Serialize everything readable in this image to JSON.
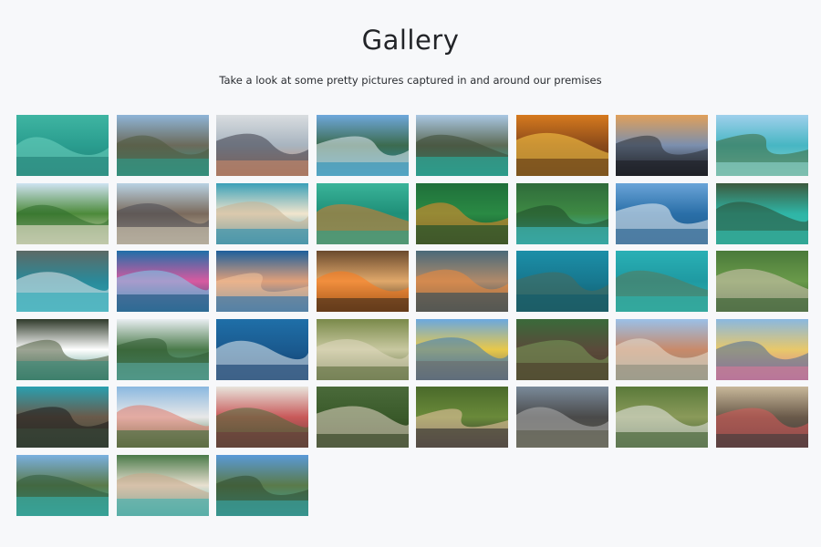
{
  "header": {
    "title": "Gallery",
    "subtitle": "Take a look at some pretty pictures captured in and around our premises"
  },
  "gallery": {
    "photos": [
      {
        "name": "photo-snorkeler-turquoise-water",
        "sky": "#3fb5a2",
        "mid": "#2a9d8f",
        "ground": "#1f7f74",
        "accent": "#6fd3c1"
      },
      {
        "name": "photo-limestone-cliffs-bay",
        "sky": "#8fb5d8",
        "mid": "#6b6a5a",
        "ground": "#2f9c8c",
        "accent": "#4e5a3e"
      },
      {
        "name": "photo-boat-deck-group",
        "sky": "#d9dde0",
        "mid": "#a8b4bf",
        "ground": "#c98a6a",
        "accent": "#3d3d48"
      },
      {
        "name": "photo-speedboat-limestone",
        "sky": "#6fa8dc",
        "mid": "#3c6b4f",
        "ground": "#2a8fb5",
        "accent": "#e8eef2"
      },
      {
        "name": "photo-cliffs-lagoon",
        "sky": "#a9c7e3",
        "mid": "#5d6b56",
        "ground": "#2ab2a4",
        "accent": "#3d4a35"
      },
      {
        "name": "photo-sunset-sea",
        "sky": "#d67a1e",
        "mid": "#8a4a1a",
        "ground": "#5a3313",
        "accent": "#ffcf4a"
      },
      {
        "name": "photo-palm-sunset",
        "sky": "#e0a05a",
        "mid": "#7b8fae",
        "ground": "#1c1e25",
        "accent": "#2a2d33"
      },
      {
        "name": "photo-islet-crystal-water",
        "sky": "#9fd0ec",
        "mid": "#47b6c3",
        "ground": "#8fd7d0",
        "accent": "#3c6a3a"
      },
      {
        "name": "photo-green-island-beach",
        "sky": "#cfe3f2",
        "mid": "#4c8a3a",
        "ground": "#e9e2cf",
        "accent": "#2e6b2a"
      },
      {
        "name": "photo-rock-formation-shore",
        "sky": "#b9d2e3",
        "mid": "#7a6a5c",
        "ground": "#d2c8b2",
        "accent": "#4a4a52"
      },
      {
        "name": "photo-aerial-sandbar",
        "sky": "#3aa0b8",
        "mid": "#f1e5cd",
        "ground": "#2a8fb0",
        "accent": "#c9b294"
      },
      {
        "name": "photo-underwater-selfie",
        "sky": "#3ab49a",
        "mid": "#1f8f78",
        "ground": "#2aa08a",
        "accent": "#e07a2a"
      },
      {
        "name": "photo-coral-clownfish",
        "sky": "#1f6f3a",
        "mid": "#2a8a44",
        "ground": "#0f4a2a",
        "accent": "#f08a2a"
      },
      {
        "name": "photo-jungle-pool",
        "sky": "#2f6b3a",
        "mid": "#3e8a44",
        "ground": "#3fc0c4",
        "accent": "#1f4a2a"
      },
      {
        "name": "photo-catamaran-slide",
        "sky": "#6aa4d8",
        "mid": "#2a6fa8",
        "ground": "#1e5a8a",
        "accent": "#f2f4f6"
      },
      {
        "name": "photo-swimmers-lagoon",
        "sky": "#3c5a3e",
        "mid": "#2fb5a6",
        "ground": "#36c2b2",
        "accent": "#2a4a32"
      },
      {
        "name": "photo-kayak-cliffs",
        "sky": "#5c6a66",
        "mid": "#2a8a9a",
        "ground": "#2aa8b5",
        "accent": "#e6ebef"
      },
      {
        "name": "photo-divers-pink",
        "sky": "#1f6fa8",
        "mid": "#d85aa0",
        "ground": "#184f7a",
        "accent": "#7fd1f0"
      },
      {
        "name": "photo-coral-reef",
        "sky": "#1d5f9c",
        "mid": "#e0a07a",
        "ground": "#2a6fa8",
        "accent": "#f3c29a"
      },
      {
        "name": "photo-clownfish-anemone",
        "sky": "#6a4a2e",
        "mid": "#e0a86a",
        "ground": "#3a2a1a",
        "accent": "#ff7a1a"
      },
      {
        "name": "photo-anemone-fish",
        "sky": "#4a6a7a",
        "mid": "#b08a6a",
        "ground": "#2a4a5a",
        "accent": "#f08a3a"
      },
      {
        "name": "photo-sea-turtle-diver",
        "sky": "#1c8fa8",
        "mid": "#17788f",
        "ground": "#0f5a6a",
        "accent": "#4a6a5a"
      },
      {
        "name": "photo-sea-turtle",
        "sky": "#2ab0b5",
        "mid": "#1f9aa2",
        "ground": "#2ab5b0",
        "accent": "#5a7a5a"
      },
      {
        "name": "photo-zipline-forest",
        "sky": "#4a7a3a",
        "mid": "#6a9a4a",
        "ground": "#2f5a2a",
        "accent": "#d8c8b8"
      },
      {
        "name": "photo-sea-cave",
        "sky": "#2f3a2a",
        "mid": "#ffffff",
        "ground": "#3a8a7a",
        "accent": "#4a5a3a"
      },
      {
        "name": "photo-james-bond-island",
        "sky": "#e9eef2",
        "mid": "#4a7a4a",
        "ground": "#5aa8a0",
        "accent": "#2f5a2f"
      },
      {
        "name": "photo-scuba-diver-blue",
        "sky": "#1f6fa8",
        "mid": "#1a5a8f",
        "ground": "#0f3a6a",
        "accent": "#e8eef2"
      },
      {
        "name": "photo-anemone-close",
        "sky": "#7a8a4a",
        "mid": "#c8c8a0",
        "ground": "#5a6a3a",
        "accent": "#e0d8c0"
      },
      {
        "name": "photo-old-town-building",
        "sky": "#6aa8e0",
        "mid": "#e8c84a",
        "ground": "#6a6a6a",
        "accent": "#3a7ab8"
      },
      {
        "name": "photo-elephant-jungle",
        "sky": "#3a6a3a",
        "mid": "#5a4a3a",
        "ground": "#4a3a2a",
        "accent": "#7a9a5a"
      },
      {
        "name": "photo-city-rooftops",
        "sky": "#9ac0e8",
        "mid": "#c88a6a",
        "ground": "#8a8a7a",
        "accent": "#e8e0d0"
      },
      {
        "name": "photo-clock-tower-street",
        "sky": "#8ab8e0",
        "mid": "#e8c86a",
        "ground": "#d87a9a",
        "accent": "#4a6a9a"
      },
      {
        "name": "photo-elephant-woman",
        "sky": "#2aa0b0",
        "mid": "#6a5a4a",
        "ground": "#3a4a3a",
        "accent": "#1a1a1a"
      },
      {
        "name": "photo-big-buddha",
        "sky": "#8ab8e0",
        "mid": "#e8e8e8",
        "ground": "#3a6a3a",
        "accent": "#e07a6a"
      },
      {
        "name": "photo-colonial-house",
        "sky": "#e8e4dc",
        "mid": "#c85a5a",
        "ground": "#6a3a3a",
        "accent": "#4a6a3a"
      },
      {
        "name": "photo-zipline-rider",
        "sky": "#4a6a3a",
        "mid": "#3a5a2a",
        "ground": "#2a3a1a",
        "accent": "#e8d8c8"
      },
      {
        "name": "photo-zipline-selfie",
        "sky": "#4a6a2a",
        "mid": "#6a8a3a",
        "ground": "#2a2a2a",
        "accent": "#f0c8a8"
      },
      {
        "name": "photo-atv-group",
        "sky": "#7a8a9a",
        "mid": "#4a4a4a",
        "ground": "#5a5a4a",
        "accent": "#b0b0b0"
      },
      {
        "name": "photo-canopy-walk",
        "sky": "#5a7a3a",
        "mid": "#8a9a5a",
        "ground": "#3a5a2a",
        "accent": "#e8e8e8"
      },
      {
        "name": "photo-atv-riders",
        "sky": "#c8b89a",
        "mid": "#6a5a4a",
        "ground": "#3a3a3a",
        "accent": "#d85a5a"
      },
      {
        "name": "photo-maya-bay",
        "sky": "#7ab0e0",
        "mid": "#5a7a4a",
        "ground": "#3ab5b0",
        "accent": "#2f5a3a"
      },
      {
        "name": "photo-longtail-boat-woman",
        "sky": "#4a7a4a",
        "mid": "#e8e0d0",
        "ground": "#3ab0b0",
        "accent": "#c8a88a"
      },
      {
        "name": "photo-cliffs-beach",
        "sky": "#5a9ad8",
        "mid": "#5a7a4a",
        "ground": "#3aa8a8",
        "accent": "#2f4a2f"
      }
    ]
  }
}
